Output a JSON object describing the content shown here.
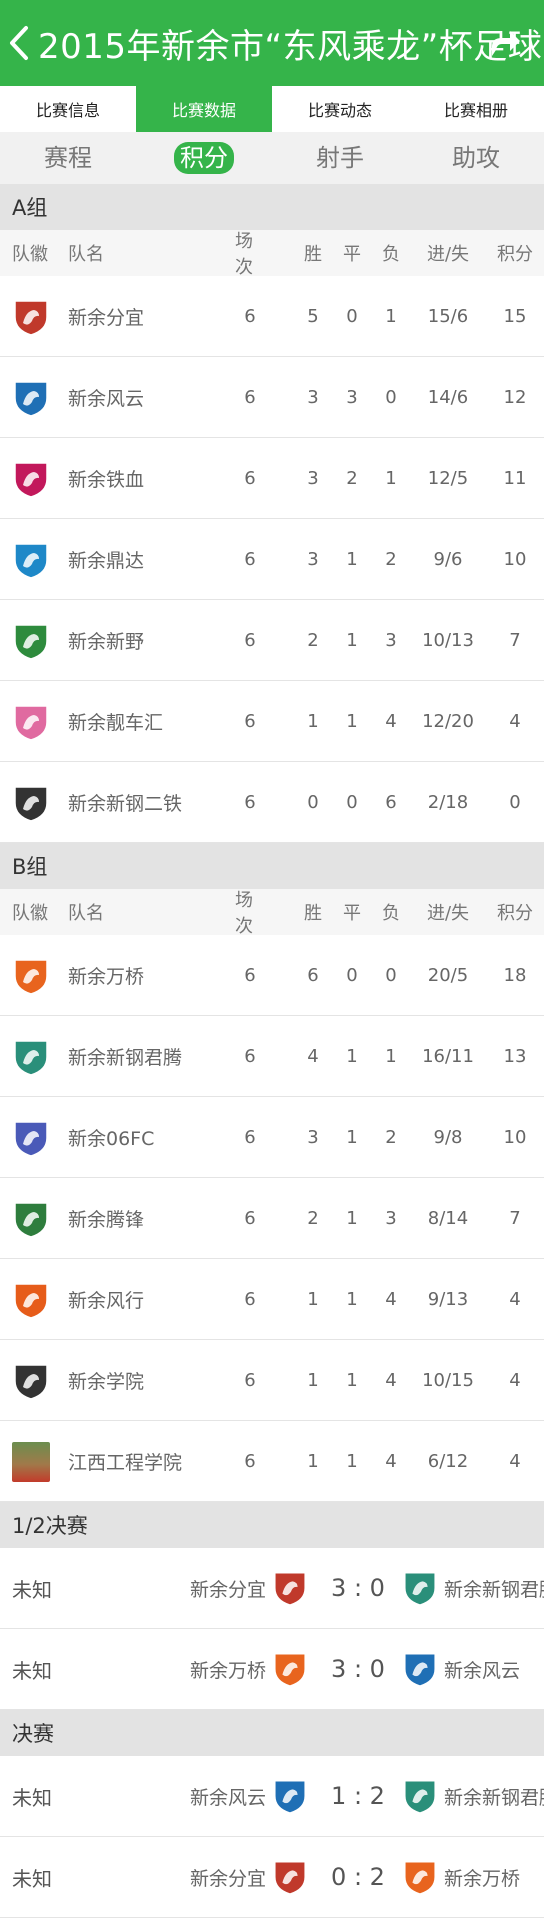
{
  "header": {
    "title": "2015年新余市“东风乘龙”杯足球"
  },
  "tabs": [
    {
      "label": "比赛信息",
      "active": false
    },
    {
      "label": "比赛数据",
      "active": true
    },
    {
      "label": "比赛动态",
      "active": false
    },
    {
      "label": "比赛相册",
      "active": false
    }
  ],
  "subtabs": [
    {
      "label": "赛程",
      "active": false
    },
    {
      "label": "积分",
      "active": true
    },
    {
      "label": "射手",
      "active": false
    },
    {
      "label": "助攻",
      "active": false
    }
  ],
  "columns": {
    "badge": "队徽",
    "team": "队名",
    "played": "场次",
    "won": "胜",
    "drawn": "平",
    "lost": "负",
    "goals": "进/失",
    "points": "积分"
  },
  "groups": [
    {
      "name": "A组",
      "teams": [
        {
          "name": "新余分宜",
          "played": "6",
          "won": "5",
          "drawn": "0",
          "lost": "1",
          "goals": "15/6",
          "points": "15",
          "badge_text": "UNICORN",
          "badge_color": "#c0392b"
        },
        {
          "name": "新余风云",
          "played": "6",
          "won": "3",
          "drawn": "3",
          "lost": "0",
          "goals": "14/6",
          "points": "12",
          "badge_text": "DRAGON",
          "badge_color": "#1f6fb5"
        },
        {
          "name": "新余铁血",
          "played": "6",
          "won": "3",
          "drawn": "2",
          "lost": "1",
          "goals": "12/5",
          "points": "11",
          "badge_text": "GRIFFIN",
          "badge_color": "#c2185b"
        },
        {
          "name": "新余鼎达",
          "played": "6",
          "won": "3",
          "drawn": "1",
          "lost": "2",
          "goals": "9/6",
          "points": "10",
          "badge_text": "TURTLES",
          "badge_color": "#1e88c8"
        },
        {
          "name": "新余新野",
          "played": "6",
          "won": "2",
          "drawn": "1",
          "lost": "3",
          "goals": "10/13",
          "points": "7",
          "badge_text": "KIRIN",
          "badge_color": "#2e8b3d"
        },
        {
          "name": "新余靓车汇",
          "played": "6",
          "won": "1",
          "drawn": "1",
          "lost": "4",
          "goals": "12/20",
          "points": "4",
          "badge_text": "MERMAID",
          "badge_color": "#e06aa0"
        },
        {
          "name": "新余新钢二铁",
          "played": "6",
          "won": "0",
          "drawn": "0",
          "lost": "6",
          "goals": "2/18",
          "points": "0",
          "badge_text": "RAPTORS",
          "badge_color": "#333333"
        }
      ]
    },
    {
      "name": "B组",
      "teams": [
        {
          "name": "新余万桥",
          "played": "6",
          "won": "6",
          "drawn": "0",
          "lost": "0",
          "goals": "20/5",
          "points": "18",
          "badge_text": "HORSE",
          "badge_color": "#e8641e"
        },
        {
          "name": "新余新钢君腾",
          "played": "6",
          "won": "4",
          "drawn": "1",
          "lost": "1",
          "goals": "16/11",
          "points": "13",
          "badge_text": "LEOPARD",
          "badge_color": "#2a8f7a"
        },
        {
          "name": "新余06FC",
          "played": "6",
          "won": "3",
          "drawn": "1",
          "lost": "2",
          "goals": "9/8",
          "points": "10",
          "badge_text": "DEER",
          "badge_color": "#4a5ab8"
        },
        {
          "name": "新余腾锋",
          "played": "6",
          "won": "2",
          "drawn": "1",
          "lost": "3",
          "goals": "8/14",
          "points": "7",
          "badge_text": "TIGER",
          "badge_color": "#2e7d3d"
        },
        {
          "name": "新余风行",
          "played": "6",
          "won": "1",
          "drawn": "1",
          "lost": "4",
          "goals": "9/13",
          "points": "4",
          "badge_text": "PHOENIX",
          "badge_color": "#e65c1a"
        },
        {
          "name": "新余学院",
          "played": "6",
          "won": "1",
          "drawn": "1",
          "lost": "4",
          "goals": "10/15",
          "points": "4",
          "badge_text": "STRIKER",
          "badge_color": "#333333"
        },
        {
          "name": "江西工程学院",
          "played": "6",
          "won": "1",
          "drawn": "1",
          "lost": "4",
          "goals": "6/12",
          "points": "4",
          "badge_text": "",
          "badge_color": "#8a6d4a"
        }
      ]
    }
  ],
  "knockouts": [
    {
      "name": "1/2决赛",
      "matches": [
        {
          "status": "未知",
          "home": "新余分宜",
          "score": "3 : 0",
          "away": "新余新钢君腾",
          "home_color": "#c0392b",
          "away_color": "#2a8f7a"
        },
        {
          "status": "未知",
          "home": "新余万桥",
          "score": "3 : 0",
          "away": "新余风云",
          "home_color": "#e8641e",
          "away_color": "#1f6fb5"
        }
      ]
    },
    {
      "name": "决赛",
      "matches": [
        {
          "status": "未知",
          "home": "新余风云",
          "score": "1 : 2",
          "away": "新余新钢君腾",
          "home_color": "#1f6fb5",
          "away_color": "#2a8f7a"
        },
        {
          "status": "未知",
          "home": "新余分宜",
          "score": "0 : 2",
          "away": "新余万桥",
          "home_color": "#c0392b",
          "away_color": "#e8641e"
        }
      ]
    }
  ]
}
